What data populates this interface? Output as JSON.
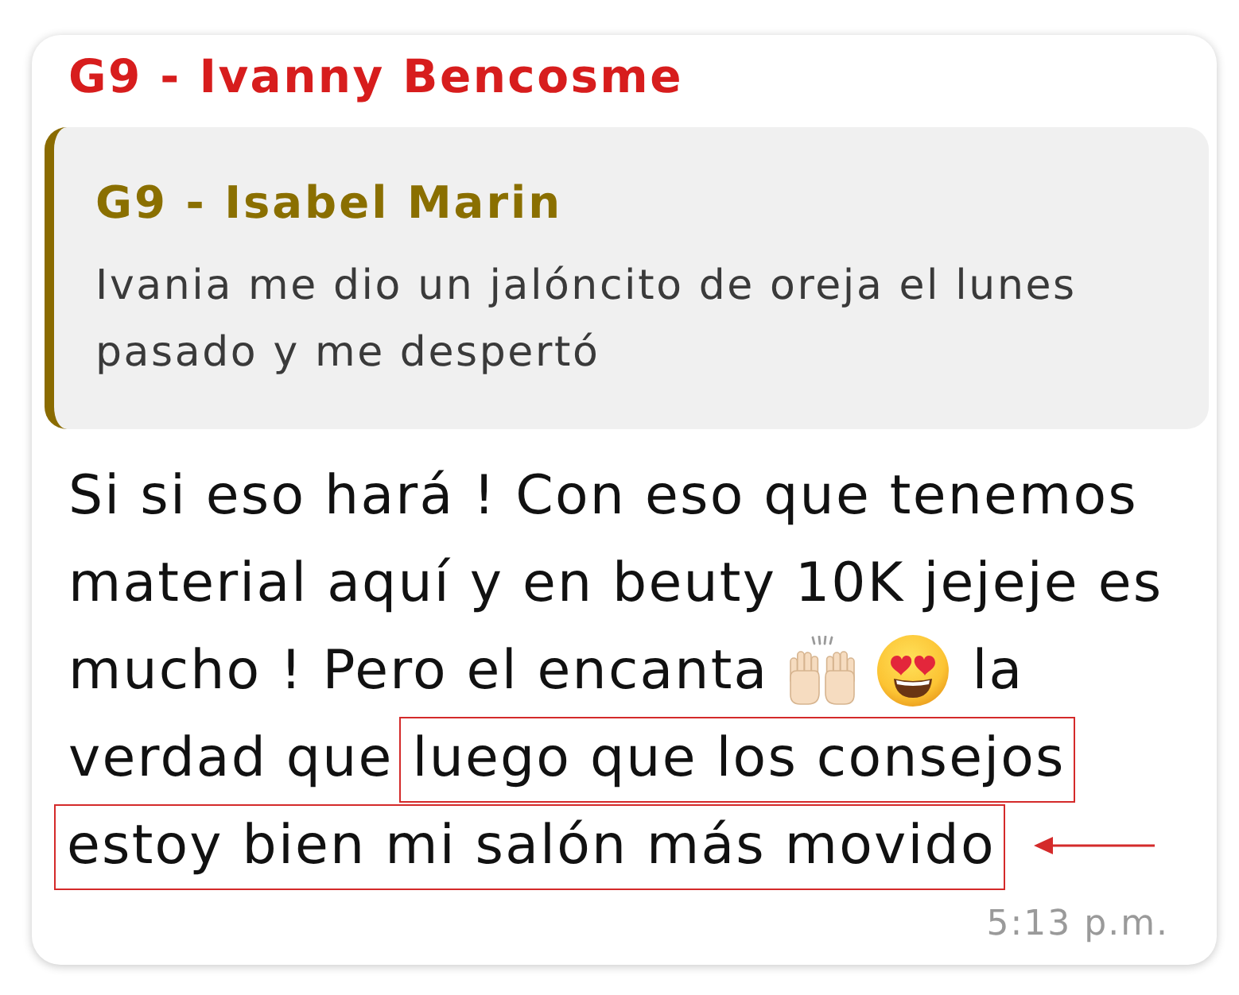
{
  "sender": {
    "name": "G9 - Ivanny Bencosme"
  },
  "quoted": {
    "name": "G9 - Isabel Marin",
    "text": "Ivania me dio un jalóncito de oreja el lunes pasado y me despertó"
  },
  "message": {
    "lines": [
      {
        "segments": [
          {
            "kind": "text",
            "text": "Si si eso hará ! Con eso que tenemos",
            "highlighted": false,
            "arrow": false
          }
        ]
      },
      {
        "segments": [
          {
            "kind": "text",
            "text": "material aquí y en beuty 10K jejeje es",
            "highlighted": false,
            "arrow": false
          }
        ]
      },
      {
        "segments": [
          {
            "kind": "text",
            "text": "mucho ! Pero el encanta",
            "highlighted": false,
            "arrow": false
          },
          {
            "kind": "hands"
          },
          {
            "kind": "hearts"
          },
          {
            "kind": "text",
            "text": "la",
            "highlighted": false,
            "arrow": false
          }
        ]
      },
      {
        "segments": [
          {
            "kind": "text",
            "text": "verdad que",
            "highlighted": false,
            "arrow": false
          },
          {
            "kind": "text",
            "text": "luego que los consejos",
            "highlighted": true,
            "arrow": false
          }
        ]
      },
      {
        "segments": [
          {
            "kind": "text",
            "text": "estoy bien mi salón más movido",
            "highlighted": true,
            "arrow": true
          }
        ]
      }
    ],
    "time": "5:13 p.m."
  }
}
